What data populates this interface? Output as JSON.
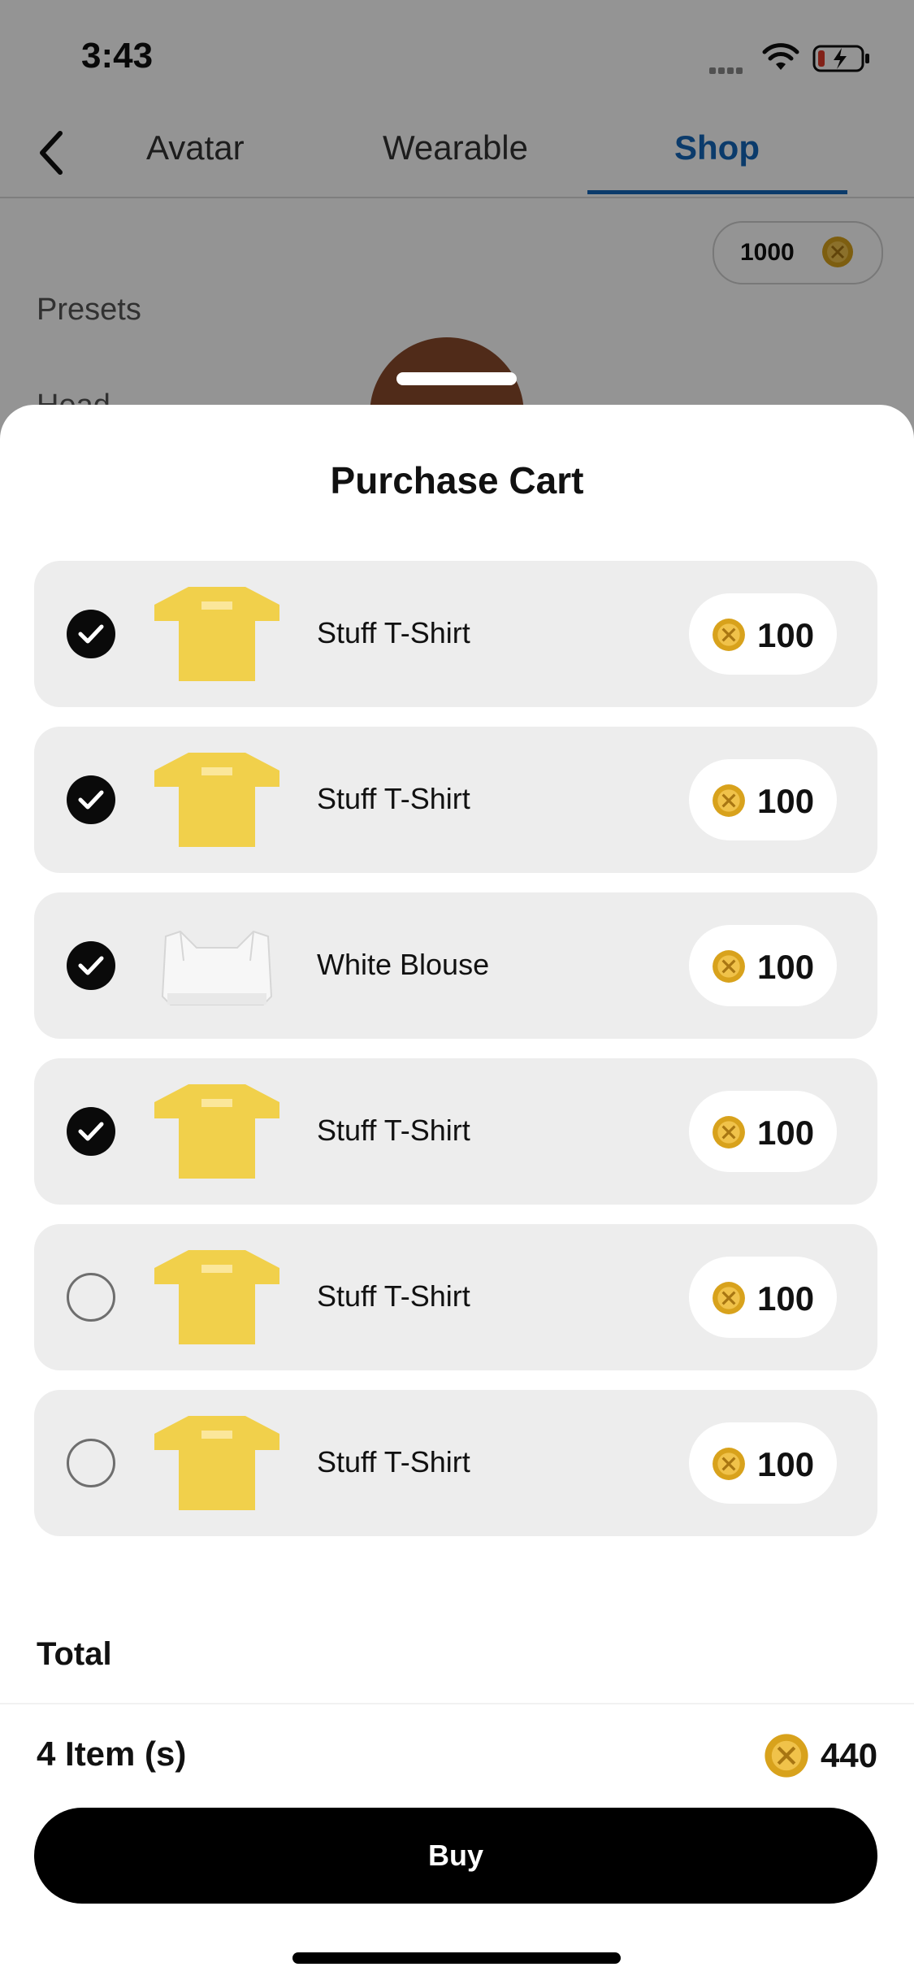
{
  "status_bar": {
    "time": "3:43"
  },
  "nav": {
    "tabs": [
      {
        "label": "Avatar"
      },
      {
        "label": "Wearable"
      },
      {
        "label": "Shop",
        "active": true
      }
    ]
  },
  "balance": {
    "amount": "1000"
  },
  "background_labels": {
    "presets": "Presets",
    "head": "Head"
  },
  "cart": {
    "title": "Purchase Cart",
    "items": [
      {
        "name": "Stuff T-Shirt",
        "price": "100",
        "selected": true,
        "thumb_icon": "yellow-tshirt-icon"
      },
      {
        "name": "Stuff T-Shirt",
        "price": "100",
        "selected": true,
        "thumb_icon": "yellow-tshirt-icon"
      },
      {
        "name": "White Blouse",
        "price": "100",
        "selected": true,
        "thumb_icon": "white-blouse-icon"
      },
      {
        "name": "Stuff T-Shirt",
        "price": "100",
        "selected": true,
        "thumb_icon": "yellow-tshirt-icon"
      },
      {
        "name": "Stuff T-Shirt",
        "price": "100",
        "selected": false,
        "thumb_icon": "yellow-tshirt-icon"
      },
      {
        "name": "Stuff T-Shirt",
        "price": "100",
        "selected": false,
        "thumb_icon": "yellow-tshirt-icon"
      }
    ]
  },
  "summary": {
    "total_label": "Total",
    "items_count": "4 Item (s)",
    "total_value": "440"
  },
  "buy_button": {
    "label": "Buy"
  },
  "colors": {
    "accent": "#1466b8",
    "coin": "#d8a21c",
    "shirt": "#f1d04b",
    "card_bg": "#ededed",
    "button_bg": "#000000"
  }
}
